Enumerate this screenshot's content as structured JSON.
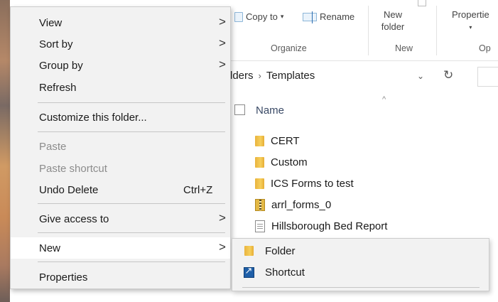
{
  "ribbon": {
    "copy_to": "Copy to",
    "copy_to_caret": "▾",
    "rename": "Rename",
    "new_folder_line1": "New",
    "new_folder_line2": "folder",
    "properties": "Propertie",
    "properties_caret": "▾",
    "groups": {
      "organize": "Organize",
      "new": "New",
      "open": "Op"
    }
  },
  "address_bar": {
    "parent_partial": "lders",
    "separator": "›",
    "current": "Templates",
    "dropdown_icon": "chevron-down-icon",
    "refresh_icon": "refresh-icon"
  },
  "file_list": {
    "header_name": "Name",
    "sort_caret": "^",
    "items": [
      {
        "name": "CERT",
        "icon": "folder-icon"
      },
      {
        "name": "Custom",
        "icon": "folder-icon"
      },
      {
        "name": "ICS Forms to test",
        "icon": "folder-icon"
      },
      {
        "name": "arrl_forms_0",
        "icon": "zip-folder-icon"
      },
      {
        "name": "Hillsborough Bed Report",
        "icon": "document-icon"
      }
    ]
  },
  "context_menu": {
    "view": "View",
    "sort_by": "Sort by",
    "group_by": "Group by",
    "refresh": "Refresh",
    "customize": "Customize this folder...",
    "paste": "Paste",
    "paste_shortcut": "Paste shortcut",
    "undo_delete": "Undo Delete",
    "undo_delete_shortcut": "Ctrl+Z",
    "give_access": "Give access to",
    "new": "New",
    "properties": "Properties",
    "submenu_arrow": ">"
  },
  "new_submenu": {
    "folder": "Folder",
    "shortcut": "Shortcut"
  },
  "colors": {
    "menu_background": "#f2f2f2",
    "menu_highlight": "#ffffff",
    "disabled_text": "#8c8c8c",
    "folder_yellow": "#f6cf5c"
  }
}
